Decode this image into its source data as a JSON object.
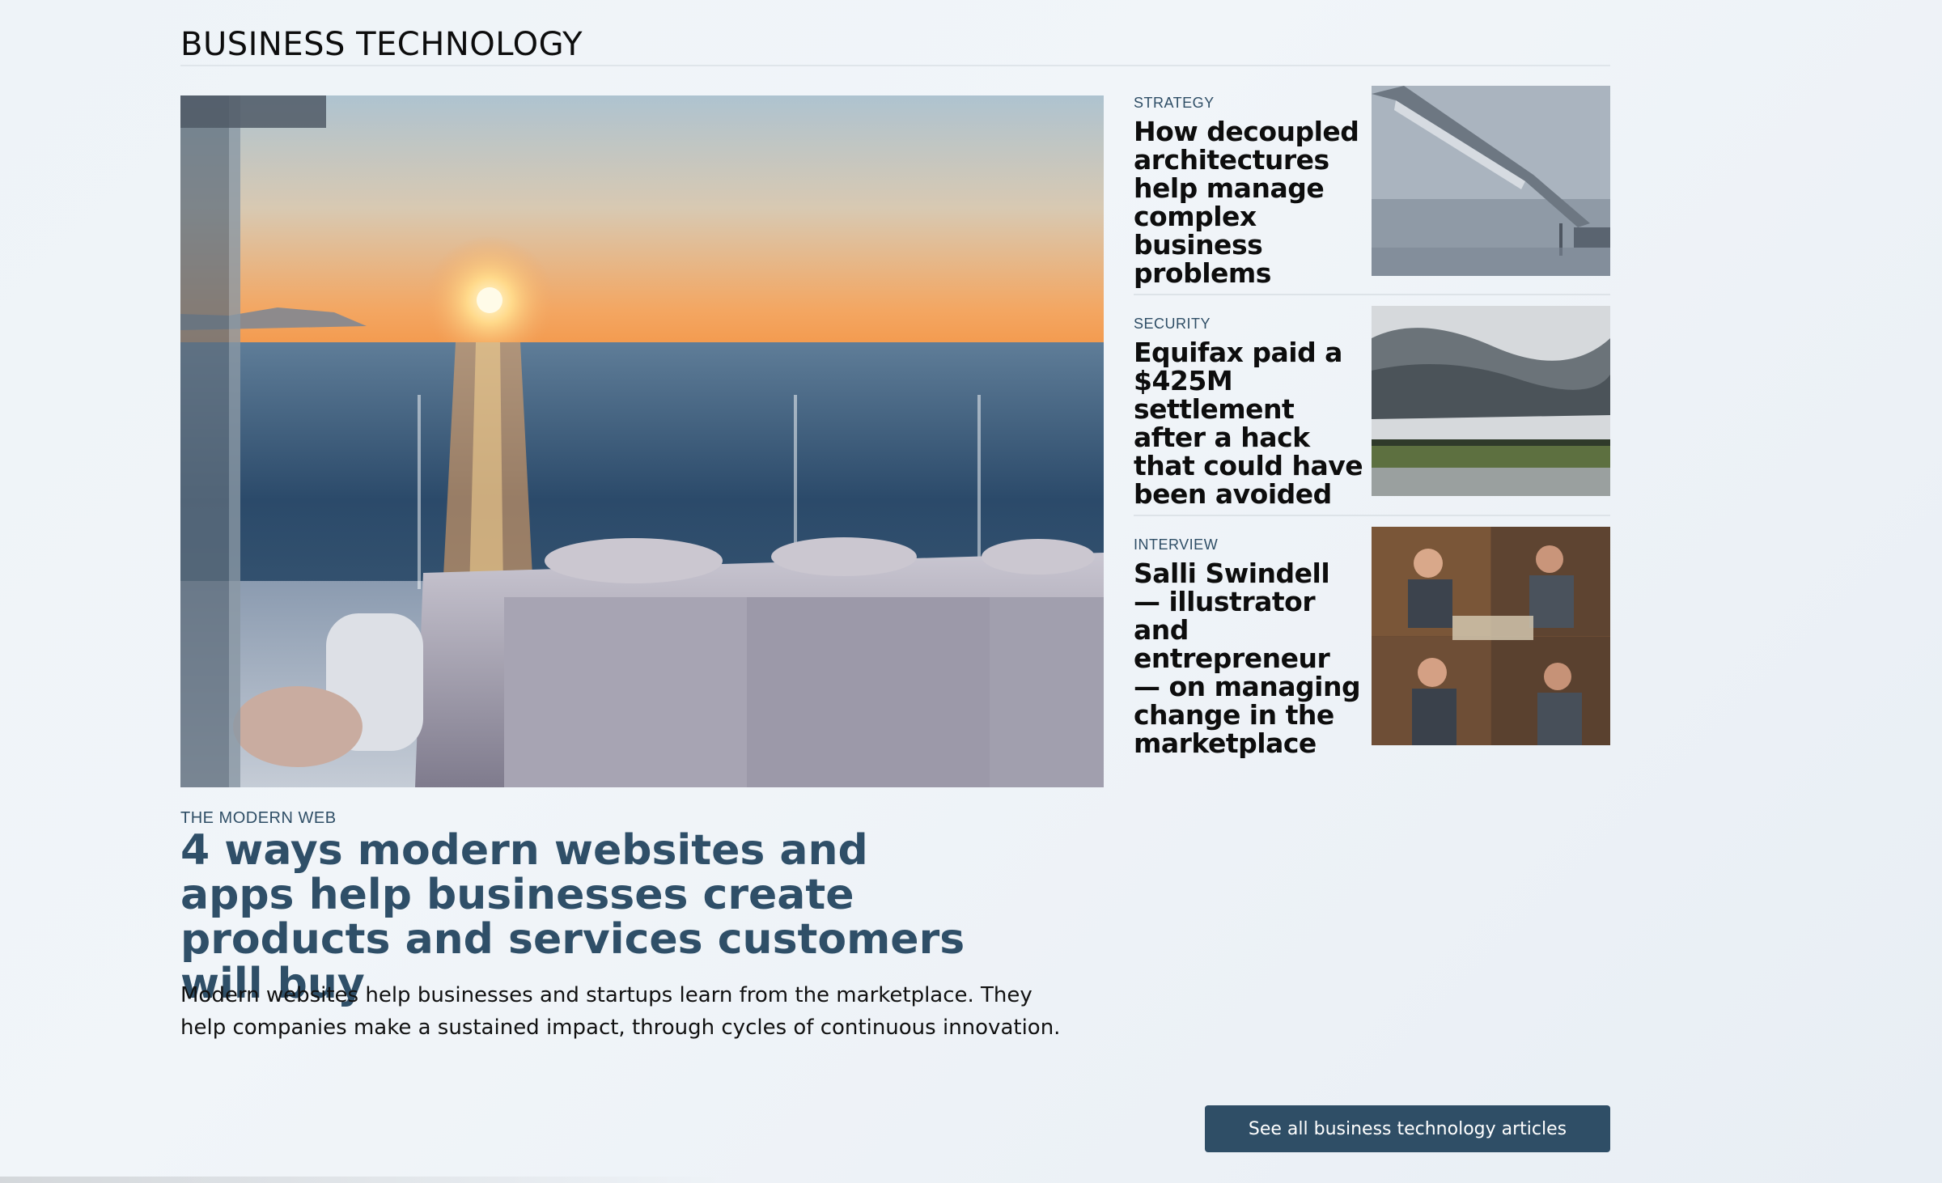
{
  "section": {
    "title": "BUSINESS TECHNOLOGY"
  },
  "hero": {
    "image_icon": "photo-icon",
    "kicker": "THE MODERN WEB",
    "headline": "4 ways modern websites and apps help businesses create products and services customers will buy",
    "description": "Modern websites help businesses and startups learn from the marketplace. They help companies make a sustained impact, through cycles of continuous innovation."
  },
  "side_articles": [
    {
      "kicker": "STRATEGY",
      "headline": "How decoupled architectures help manage complex business problems"
    },
    {
      "kicker": "SECURITY",
      "headline": "Equifax paid a $425M settlement after a hack that could have been avoided"
    },
    {
      "kicker": "INTERVIEW",
      "headline": "Salli Swindell — illustrator and entrepreneur — on managing change in the marketplace"
    }
  ],
  "cta": {
    "label": "See all business technology articles"
  },
  "colors": {
    "accent": "#2f4e66",
    "background": "#eef3f8",
    "text": "#0d0d0d"
  }
}
